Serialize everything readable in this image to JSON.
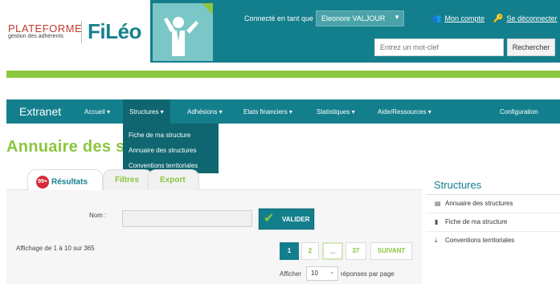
{
  "colors": {
    "primary": "#147f8c",
    "accent": "#8cc63f",
    "badge": "#d62b3a"
  },
  "logo": {
    "plateforme": "PLATEFORME",
    "sub": "gestion des adhérents",
    "brand": "FiLéo"
  },
  "header": {
    "connected_label": "Connecté en tant que",
    "user_name": "Eleonore VALJOUR",
    "mon_compte": "Mon compte",
    "deconnecter": "Se déconnecter",
    "search_placeholder": "Entrez un mot-clef",
    "search_button": "Rechercher"
  },
  "nav": {
    "brand": "Extranet",
    "items": [
      "Accueil ▾",
      "Structures ▾",
      "Adhésions ▾",
      "Etats financiers ▾",
      "Statistiques ▾",
      "Aide/Ressources ▾"
    ],
    "config": "Configuration"
  },
  "dropdown": [
    "Fiche de ma structure",
    "Annuaire des structures",
    "Conventions territoriales"
  ],
  "page_title": "Annuaire des st",
  "tabs": {
    "badge": "99+",
    "results": "Résultats",
    "filtres": "Filtres",
    "export": "Export"
  },
  "form": {
    "nom_label": "Nom :",
    "valider": "VALIDER"
  },
  "results": {
    "affichage": "Affichage de 1 à 10 sur 365",
    "pages": [
      "1",
      "2",
      "...",
      "37"
    ],
    "next": "SUIVANT",
    "afficher": "Afficher",
    "per_page": "10",
    "reponses": "réponses par page"
  },
  "sidebar": {
    "title": "Structures",
    "items": [
      "Annuaire des structures",
      "Fiche de ma structure",
      "Conventions territoriales"
    ]
  }
}
